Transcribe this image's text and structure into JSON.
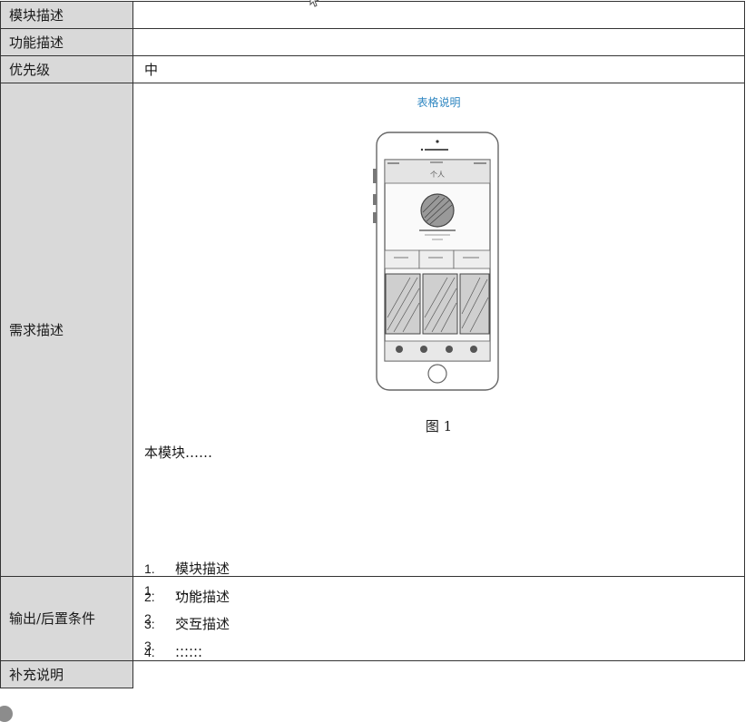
{
  "rows": {
    "module_desc": {
      "label": "模块描述",
      "value": ""
    },
    "function_desc": {
      "label": "功能描述",
      "value": ""
    },
    "priority": {
      "label": "优先级",
      "value": "中"
    },
    "requirement": {
      "label": "需求描述",
      "caption_link": "表格说明",
      "figure": {
        "screen_title": "个人",
        "label": "图 1"
      },
      "intro": "本模块……",
      "items": [
        {
          "num": "1.",
          "text": "模块描述"
        },
        {
          "num": "2.",
          "text": "功能描述"
        },
        {
          "num": "3.",
          "text": "交互描述"
        },
        {
          "num": "4.",
          "text": "……"
        }
      ]
    },
    "output": {
      "label": "输出/后置条件",
      "items": [
        {
          "num": "1.",
          "text": "……"
        },
        {
          "num": "2.",
          "text": "……"
        },
        {
          "num": "3.",
          "text": "……"
        }
      ]
    },
    "extra": {
      "label": "补充说明",
      "value": ""
    }
  },
  "colors": {
    "label_bg": "#d9d9d9",
    "link": "#2e86c1",
    "border": "#333333"
  },
  "icons": {
    "cursor": "mouse-pointer-icon",
    "avatar": "user-avatar-icon"
  }
}
